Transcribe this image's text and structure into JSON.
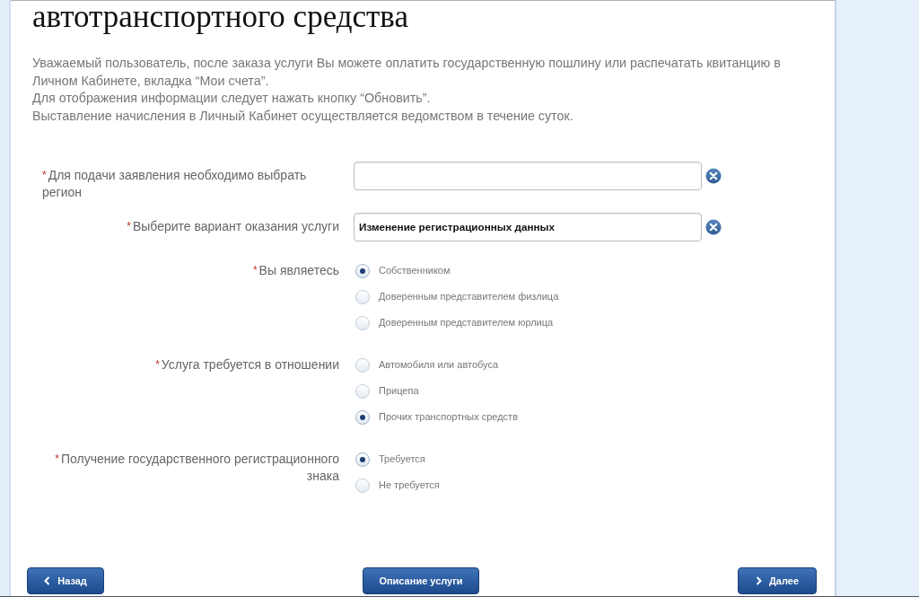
{
  "heading": "автотранспортного средства",
  "notice": [
    "Уважаемый пользователь, после заказа услуги Вы можете оплатить государственную пошлину или распечатать квитанцию в Личном Кабинете, вкладка “Мои счета”.",
    "Для отображения информации следует нажать кнопку “Обновить”.",
    "Выставление начисления в Личный Кабинет осуществляется ведомством в течение суток."
  ],
  "form": {
    "fields": [
      {
        "kind": "select",
        "required_mark": "*",
        "label": "Для подачи заявления необходимо выбрать регион",
        "align_left": true
      },
      {
        "kind": "select",
        "required_mark": "*",
        "label": "Выберите вариант оказания услуги",
        "align_left": false,
        "value": "Изменение регистрационных данных"
      },
      {
        "kind": "radio",
        "required_mark": "*",
        "label": "Вы являетесь",
        "align_left": false,
        "options": [
          {
            "label": "Собственником",
            "selected": true
          },
          {
            "label": "Доверенным представителем физлица",
            "selected": false
          },
          {
            "label": "Доверенным представителем юрлица",
            "selected": false
          }
        ]
      },
      {
        "kind": "radio",
        "required_mark": "*",
        "label": "Услуга требуется в отношении",
        "align_left": false,
        "options": [
          {
            "label": "Автомобиля или автобуса",
            "selected": false
          },
          {
            "label": "Прицепа",
            "selected": false
          },
          {
            "label": "Прочих транспортных средств",
            "selected": true
          }
        ]
      },
      {
        "kind": "radio",
        "required_mark": "*",
        "label": "Получение государственного регистрационного знака",
        "align_left": false,
        "options": [
          {
            "label": "Требуется",
            "selected": true
          },
          {
            "label": "Не требуется",
            "selected": false
          }
        ]
      }
    ]
  },
  "buttons": [
    {
      "kind": "back",
      "label": "Назад"
    },
    {
      "kind": "plain",
      "label": "Описание услуги"
    },
    {
      "kind": "next",
      "label": "Далее"
    }
  ]
}
